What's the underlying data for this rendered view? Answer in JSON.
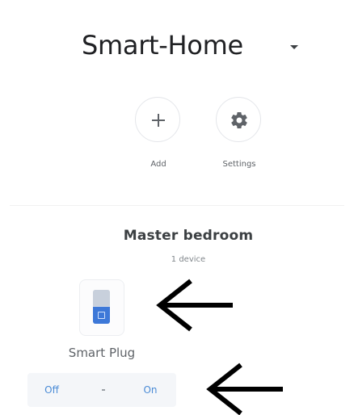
{
  "header": {
    "home_name": "Smart-Home",
    "dropdown_icon": "caret-down-icon"
  },
  "actions": [
    {
      "label": "Add",
      "icon": "plus-icon"
    },
    {
      "label": "Settings",
      "icon": "gear-icon"
    }
  ],
  "room": {
    "name": "Master bedroom",
    "device_count": "1 device",
    "devices": [
      {
        "name": "Smart Plug",
        "icon": "smart-plug-icon",
        "controls": {
          "off_label": "Off",
          "on_label": "On"
        }
      }
    ]
  },
  "annotations": {
    "icon": "arrow-left-icon",
    "color": "#000000"
  },
  "colors": {
    "accent": "#4a8bd6",
    "plug_blue": "#3d78d8",
    "control_bg": "#f4f6f9"
  }
}
